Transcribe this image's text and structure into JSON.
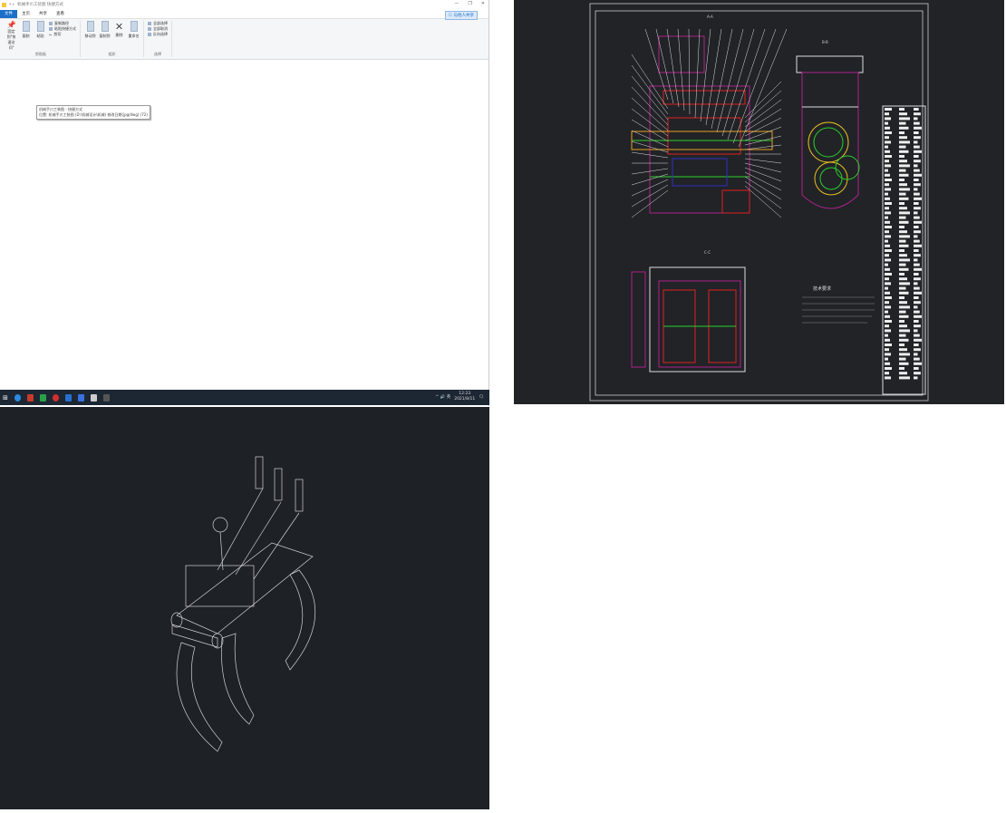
{
  "explorer": {
    "title": "机械手爪工装图  快捷方式",
    "tabs": [
      "文件",
      "主页",
      "共享",
      "查看"
    ],
    "share_button": "与他人共享",
    "ribbon": {
      "clipboard": {
        "pin": "固定到\"快速访问\"",
        "copy": "复制",
        "paste": "粘贴",
        "copy_path": "复制路径",
        "paste_shortcut": "粘贴快捷方式",
        "cut": "剪切",
        "label": "剪贴板"
      },
      "organize": {
        "move_to": "移动到",
        "copy_to": "复制到",
        "delete": "删除",
        "rename": "重命名",
        "label": "组织"
      },
      "select": {
        "select_all": "全部选择",
        "select_none": "全部取消",
        "invert": "反向选择",
        "label": "选择"
      }
    },
    "tooltip": {
      "line1": "机械手爪工装图 - 快捷方式",
      "line2": "位置: 机械手爪工装图 (D:\\机械设计\\机械) 修改日期(jpg/dwg) (72)"
    }
  },
  "taskbar": {
    "time": "12:23",
    "date": "2021/8/11",
    "tray": "^ 🔊 英"
  },
  "cad": {
    "notes_title": "技术要求",
    "view_labels": [
      "A-A",
      "B-B",
      "C-C"
    ]
  },
  "colors": {
    "cad_bg": "#212327",
    "taskbar": "#1c2733",
    "accent": "#1a6fc9"
  }
}
